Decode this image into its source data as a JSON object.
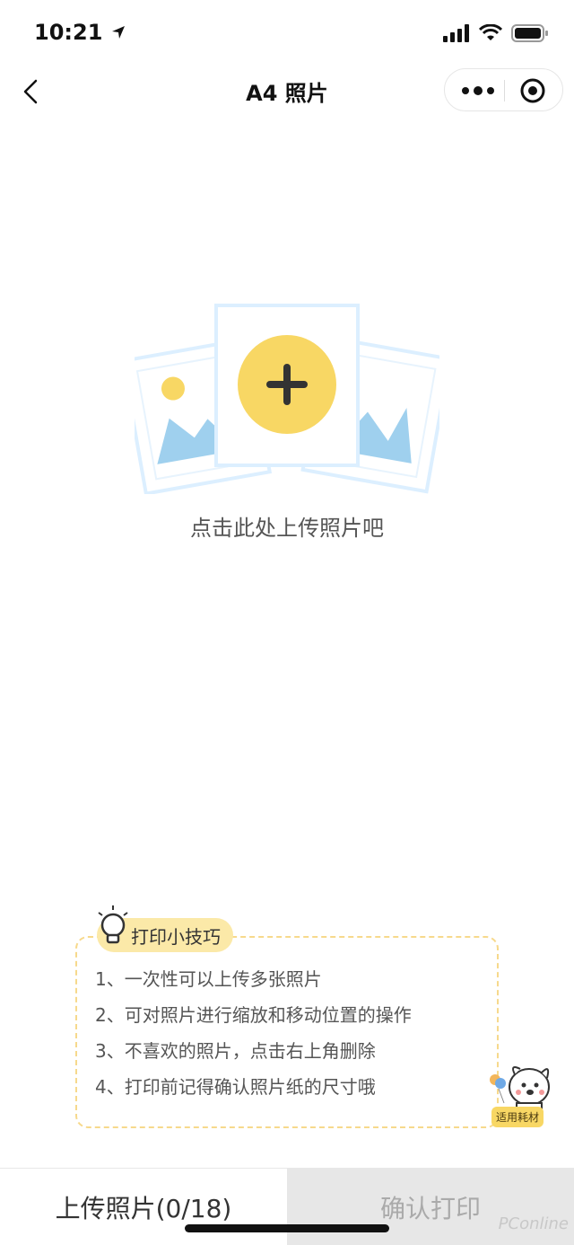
{
  "status_bar": {
    "time": "10:21"
  },
  "nav": {
    "title": "A4 照片"
  },
  "upload": {
    "hint": "点击此处上传照片吧"
  },
  "tips": {
    "title": "打印小技巧",
    "items": [
      "1、一次性可以上传多张照片",
      "2、可对照片进行缩放和移动位置的操作",
      "3、不喜欢的照片，点击右上角删除",
      "4、打印前记得确认照片纸的尺寸哦"
    ],
    "mascot_label": "适用耗材"
  },
  "bottom": {
    "upload_label": "上传照片(0/18)",
    "confirm_label": "确认打印"
  },
  "watermark": "PConline",
  "colors": {
    "accent_yellow": "#f8d764",
    "tips_bg": "#fbe9a8",
    "photo_blue": "#9fd0ee",
    "photo_frame": "#dcefff"
  },
  "icons": [
    "location-arrow-icon",
    "signal-icon",
    "wifi-icon",
    "battery-icon",
    "back-icon",
    "more-icon",
    "close-target-icon",
    "plus-icon",
    "bulb-icon",
    "mascot-icon"
  ]
}
